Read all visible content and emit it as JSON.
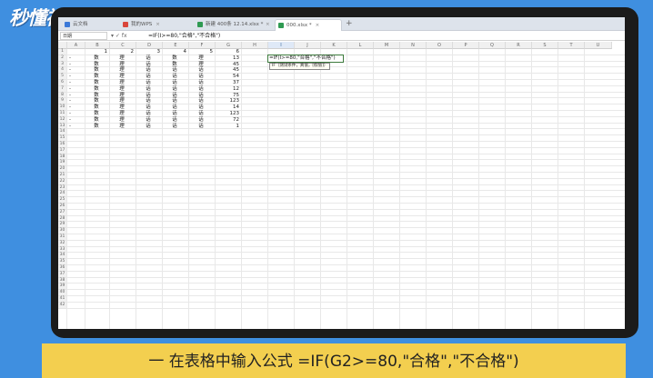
{
  "brand": {
    "logo_text": "秒懂视频"
  },
  "colors": {
    "background": "#3f8fe0",
    "caption_bg": "#f3cf4f",
    "formula_border": "#3b7a3b"
  },
  "tabs": [
    {
      "label": "云文档",
      "icon": "cloud-icon"
    },
    {
      "label": "我的WPS",
      "icon": "wps-icon"
    },
    {
      "label": "新建 400条 12.14.xlsx *",
      "icon": "sheet-icon"
    },
    {
      "label": "000.xlsx *",
      "icon": "sheet-icon"
    }
  ],
  "formula_bar": {
    "name_box": "日期",
    "icons": "▾  ✓  fx",
    "formula": "=IF(I>=80,\"合格\",\"不合格\")"
  },
  "columns": [
    "A",
    "B",
    "C",
    "D",
    "E",
    "F",
    "G",
    "H",
    "I",
    "J",
    "K",
    "L",
    "M",
    "N",
    "O",
    "P",
    "Q",
    "R",
    "S",
    "T",
    "U"
  ],
  "row_numbers": [
    "1",
    "2",
    "3",
    "4",
    "5",
    "6",
    "7",
    "8",
    "9",
    "10",
    "11",
    "12",
    "13",
    "14",
    "15",
    "16",
    "17",
    "18",
    "19",
    "20",
    "21",
    "22",
    "23",
    "24",
    "25",
    "26",
    "27",
    "28",
    "29",
    "30",
    "31",
    "32",
    "33",
    "34",
    "35",
    "36",
    "37",
    "38",
    "39",
    "40",
    "41",
    "42"
  ],
  "header_row": [
    "1",
    "2",
    "3",
    "4",
    "5",
    "6"
  ],
  "data_rows": [
    {
      "a": "-",
      "b": "数",
      "c": "理",
      "d": "话",
      "e": "数",
      "f": "理",
      "g": "13"
    },
    {
      "a": "-",
      "b": "数",
      "c": "理",
      "d": "话",
      "e": "数",
      "f": "理",
      "g": "45"
    },
    {
      "a": "-",
      "b": "数",
      "c": "理",
      "d": "话",
      "e": "话",
      "f": "话",
      "g": "45"
    },
    {
      "a": "-",
      "b": "数",
      "c": "理",
      "d": "话",
      "e": "话",
      "f": "话",
      "g": "54"
    },
    {
      "a": "-",
      "b": "数",
      "c": "理",
      "d": "话",
      "e": "话",
      "f": "话",
      "g": "37"
    },
    {
      "a": "-",
      "b": "数",
      "c": "理",
      "d": "话",
      "e": "话",
      "f": "话",
      "g": "12"
    },
    {
      "a": "-",
      "b": "数",
      "c": "理",
      "d": "话",
      "e": "话",
      "f": "话",
      "g": "75"
    },
    {
      "a": "-",
      "b": "数",
      "c": "理",
      "d": "话",
      "e": "话",
      "f": "话",
      "g": "123"
    },
    {
      "a": "-",
      "b": "数",
      "c": "理",
      "d": "话",
      "e": "话",
      "f": "话",
      "g": "14"
    },
    {
      "a": "-",
      "b": "数",
      "c": "理",
      "d": "话",
      "e": "话",
      "f": "话",
      "g": "123"
    },
    {
      "a": "-",
      "b": "数",
      "c": "理",
      "d": "话",
      "e": "话",
      "f": "话",
      "g": "72"
    },
    {
      "a": "-",
      "b": "数",
      "c": "理",
      "d": "话",
      "e": "话",
      "f": "话",
      "g": "1"
    }
  ],
  "formula_cell": "=IF(I>=80,\"合格\",\"不合格\")",
  "formula_tip": "IF（测试条件，真值，[假值]）",
  "caption": "一 在表格中输入公式 =IF(G2>=80,\"合格\",\"不合格\")"
}
